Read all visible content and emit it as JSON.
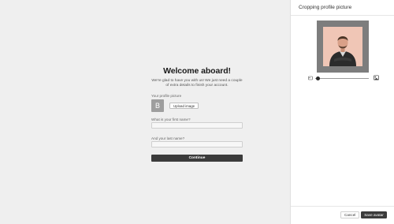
{
  "onboarding": {
    "title": "Welcome aboard!",
    "subtitle": "We're glad to have you with us! We just need a couple of extra details to finish your account.",
    "profile_picture_label": "Your profile picture",
    "avatar_initial": "B",
    "upload_label": "Upload image",
    "first_name_label": "What is your first name?",
    "first_name_value": "",
    "last_name_label": "And your last name?",
    "last_name_value": "",
    "continue_label": "Continue"
  },
  "crop_panel": {
    "title": "Cropping profile picture",
    "zoom_level": 0.05,
    "cancel_label": "Cancel",
    "save_label": "Save avatar"
  },
  "colors": {
    "primary_button": "#3b3b3b",
    "crop_frame": "#7d7d7d",
    "photo_background": "#f0c6b6"
  }
}
